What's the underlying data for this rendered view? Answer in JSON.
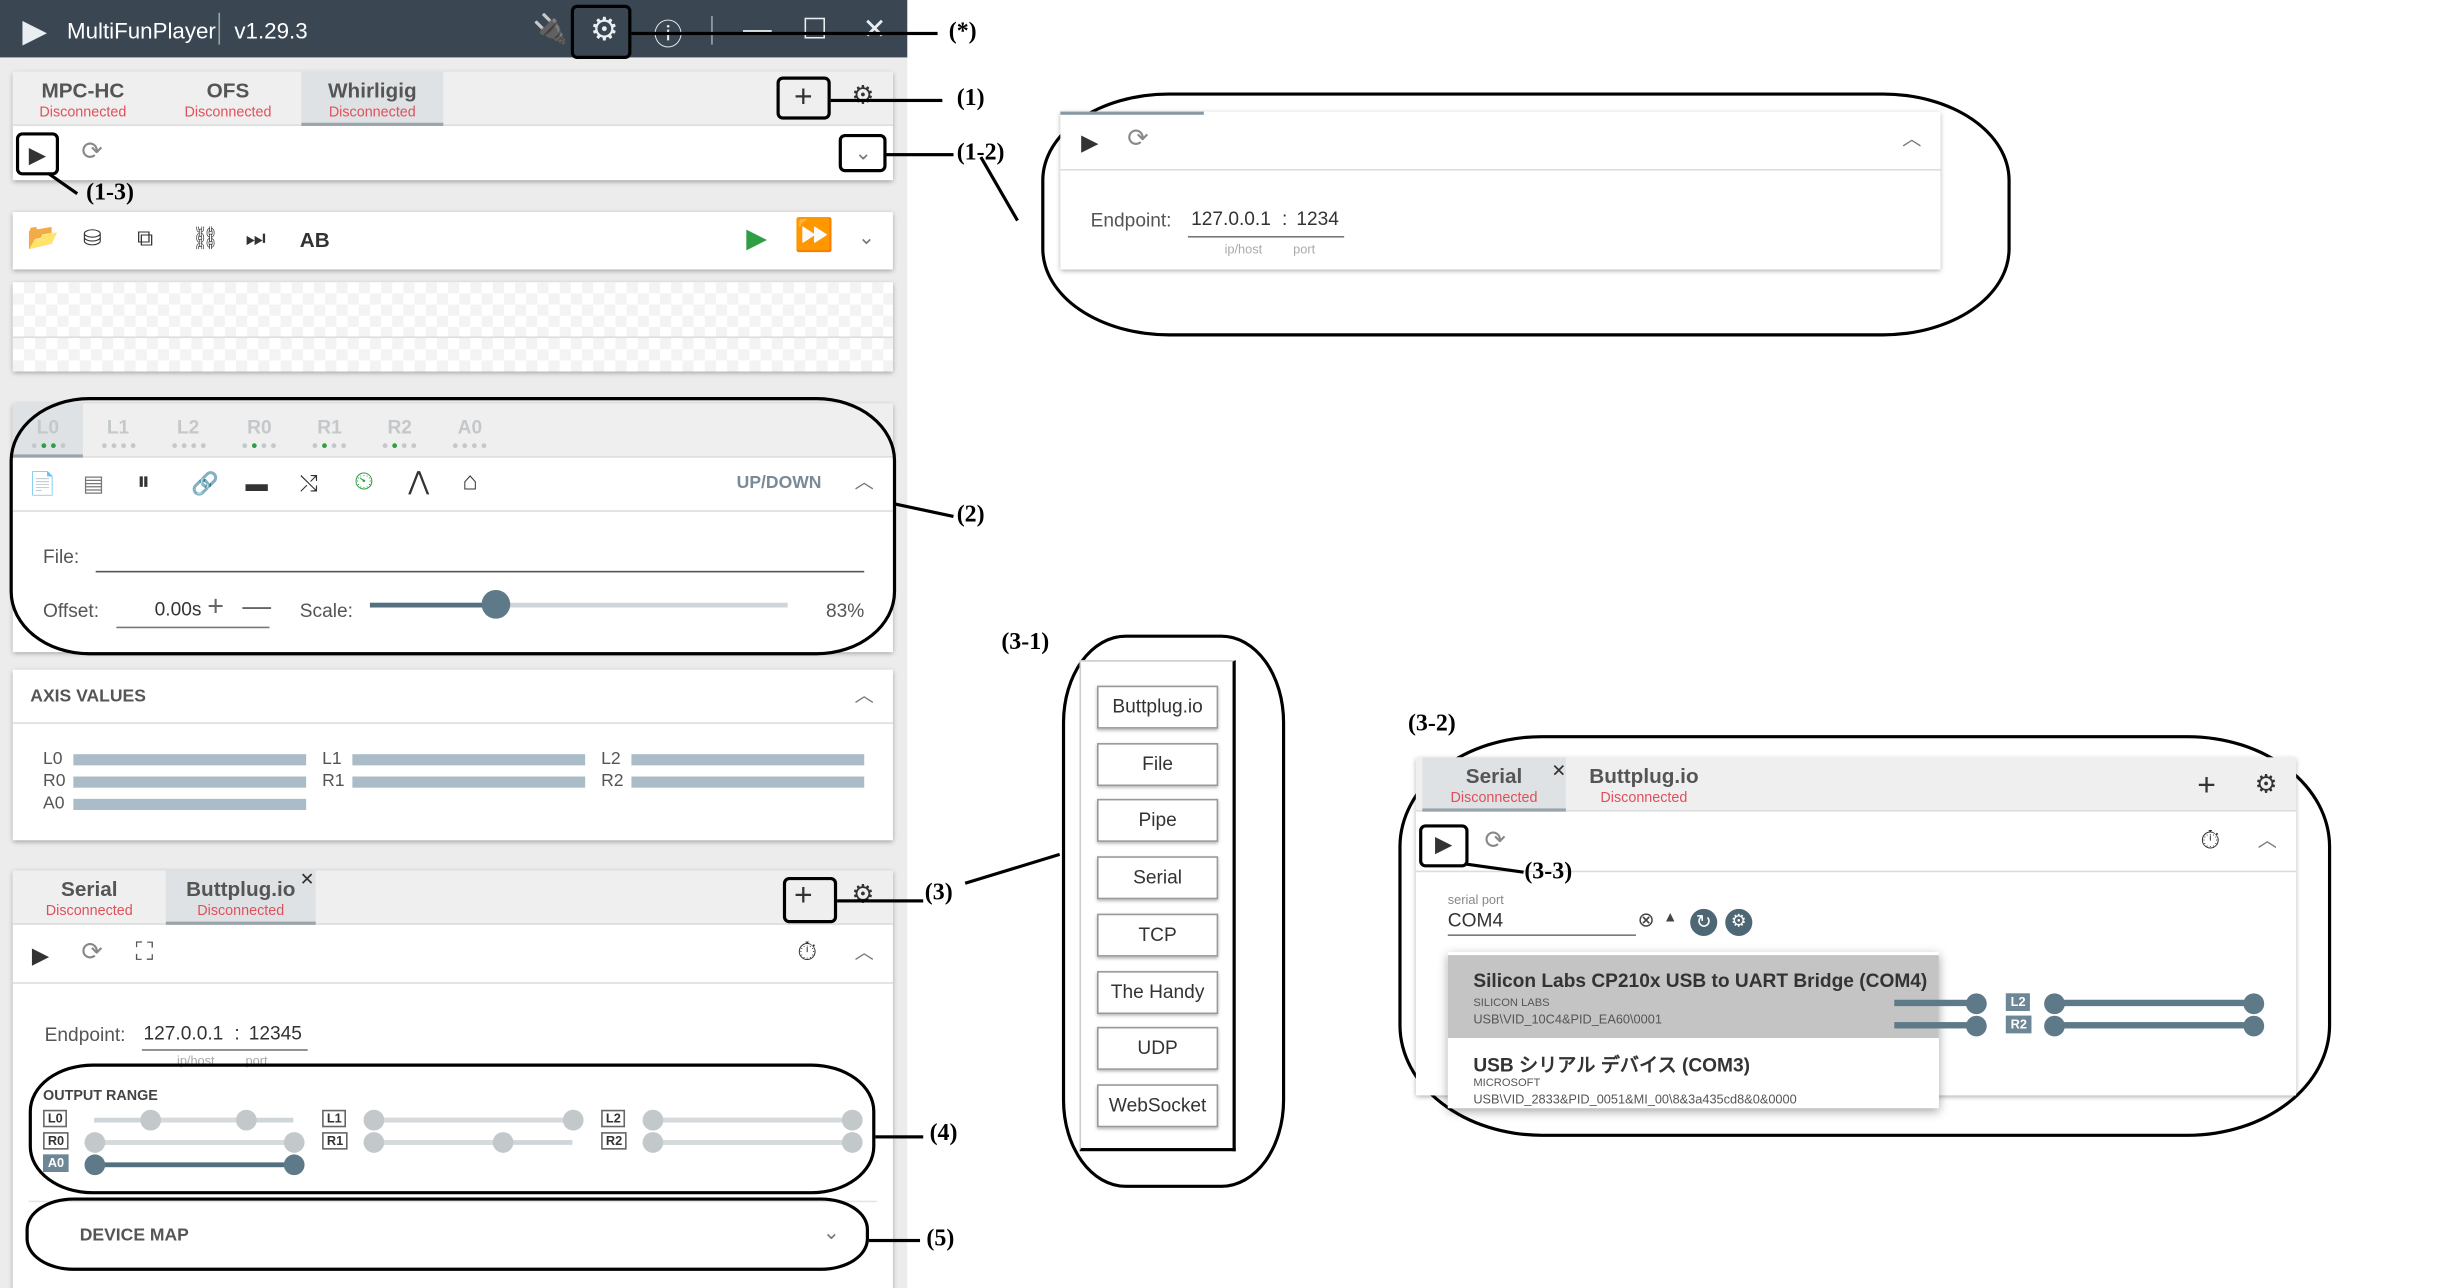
{
  "titlebar": {
    "app_name": "MultiFunPlayer",
    "version": "v1.29.3"
  },
  "annotations": {
    "star": "(*)",
    "a1": "(1)",
    "a1_2": "(1-2)",
    "a1_3": "(1-3)",
    "a2": "(2)",
    "a3": "(3)",
    "a3_1": "(3-1)",
    "a3_2": "(3-2)",
    "a3_3": "(3-3)",
    "a4": "(4)",
    "a5": "(5)"
  },
  "media_sources": {
    "tabs": [
      {
        "label": "MPC-HC",
        "status": "Disconnected"
      },
      {
        "label": "OFS",
        "status": "Disconnected"
      },
      {
        "label": "Whirligig",
        "status": "Disconnected"
      }
    ]
  },
  "toolbar": {
    "ab_label": "AB"
  },
  "axes": {
    "tabs": [
      "L0",
      "L1",
      "L2",
      "R0",
      "R1",
      "R2",
      "A0"
    ],
    "mode_label": "UP/DOWN",
    "file_label": "File:",
    "offset_label": "Offset:",
    "offset_value": "0.00s",
    "scale_label": "Scale:",
    "scale_value": "83%",
    "scale_fraction": 0.3
  },
  "axis_values": {
    "title": "AXIS VALUES",
    "items": [
      "L0",
      "L1",
      "L2",
      "R0",
      "R1",
      "R2",
      "A0"
    ]
  },
  "outputs": {
    "tabs": [
      {
        "label": "Serial",
        "status": "Disconnected"
      },
      {
        "label": "Buttplug.io",
        "status": "Disconnected"
      }
    ],
    "endpoint_label": "Endpoint:",
    "endpoint_host": "127.0.0.1",
    "endpoint_sep": ":",
    "endpoint_port": "12345",
    "host_hint": "ip/host",
    "port_hint": "port",
    "output_range_title": "OUTPUT RANGE",
    "range_axes": [
      "L0",
      "R0",
      "A0",
      "L1",
      "R1",
      "L2",
      "R2"
    ],
    "device_map_title": "DEVICE MAP"
  },
  "zoom_endpoint": {
    "endpoint_label": "Endpoint:",
    "host": "127.0.0.1",
    "sep": ":",
    "port": "1234",
    "host_hint": "ip/host",
    "port_hint": "port"
  },
  "output_menu": {
    "items": [
      "Buttplug.io",
      "File",
      "Pipe",
      "Serial",
      "TCP",
      "The Handy",
      "UDP",
      "WebSocket"
    ]
  },
  "serial_panel": {
    "tabs": [
      {
        "label": "Serial",
        "status": "Disconnected"
      },
      {
        "label": "Buttplug.io",
        "status": "Disconnected"
      }
    ],
    "port_field_label": "serial port",
    "port_value": "COM4",
    "options": [
      {
        "title": "Silicon Labs CP210x USB to UART Bridge (COM4)",
        "maker": "SILICON LABS",
        "id": "USB\\VID_10C4&PID_EA60\\0001"
      },
      {
        "title": "USB シリアル デバイス (COM3)",
        "maker": "MICROSOFT",
        "id": "USB\\VID_2833&PID_0051&MI_00\\8&3a435cd8&0&0000"
      }
    ],
    "axis_badges": [
      "L2",
      "R2"
    ]
  }
}
